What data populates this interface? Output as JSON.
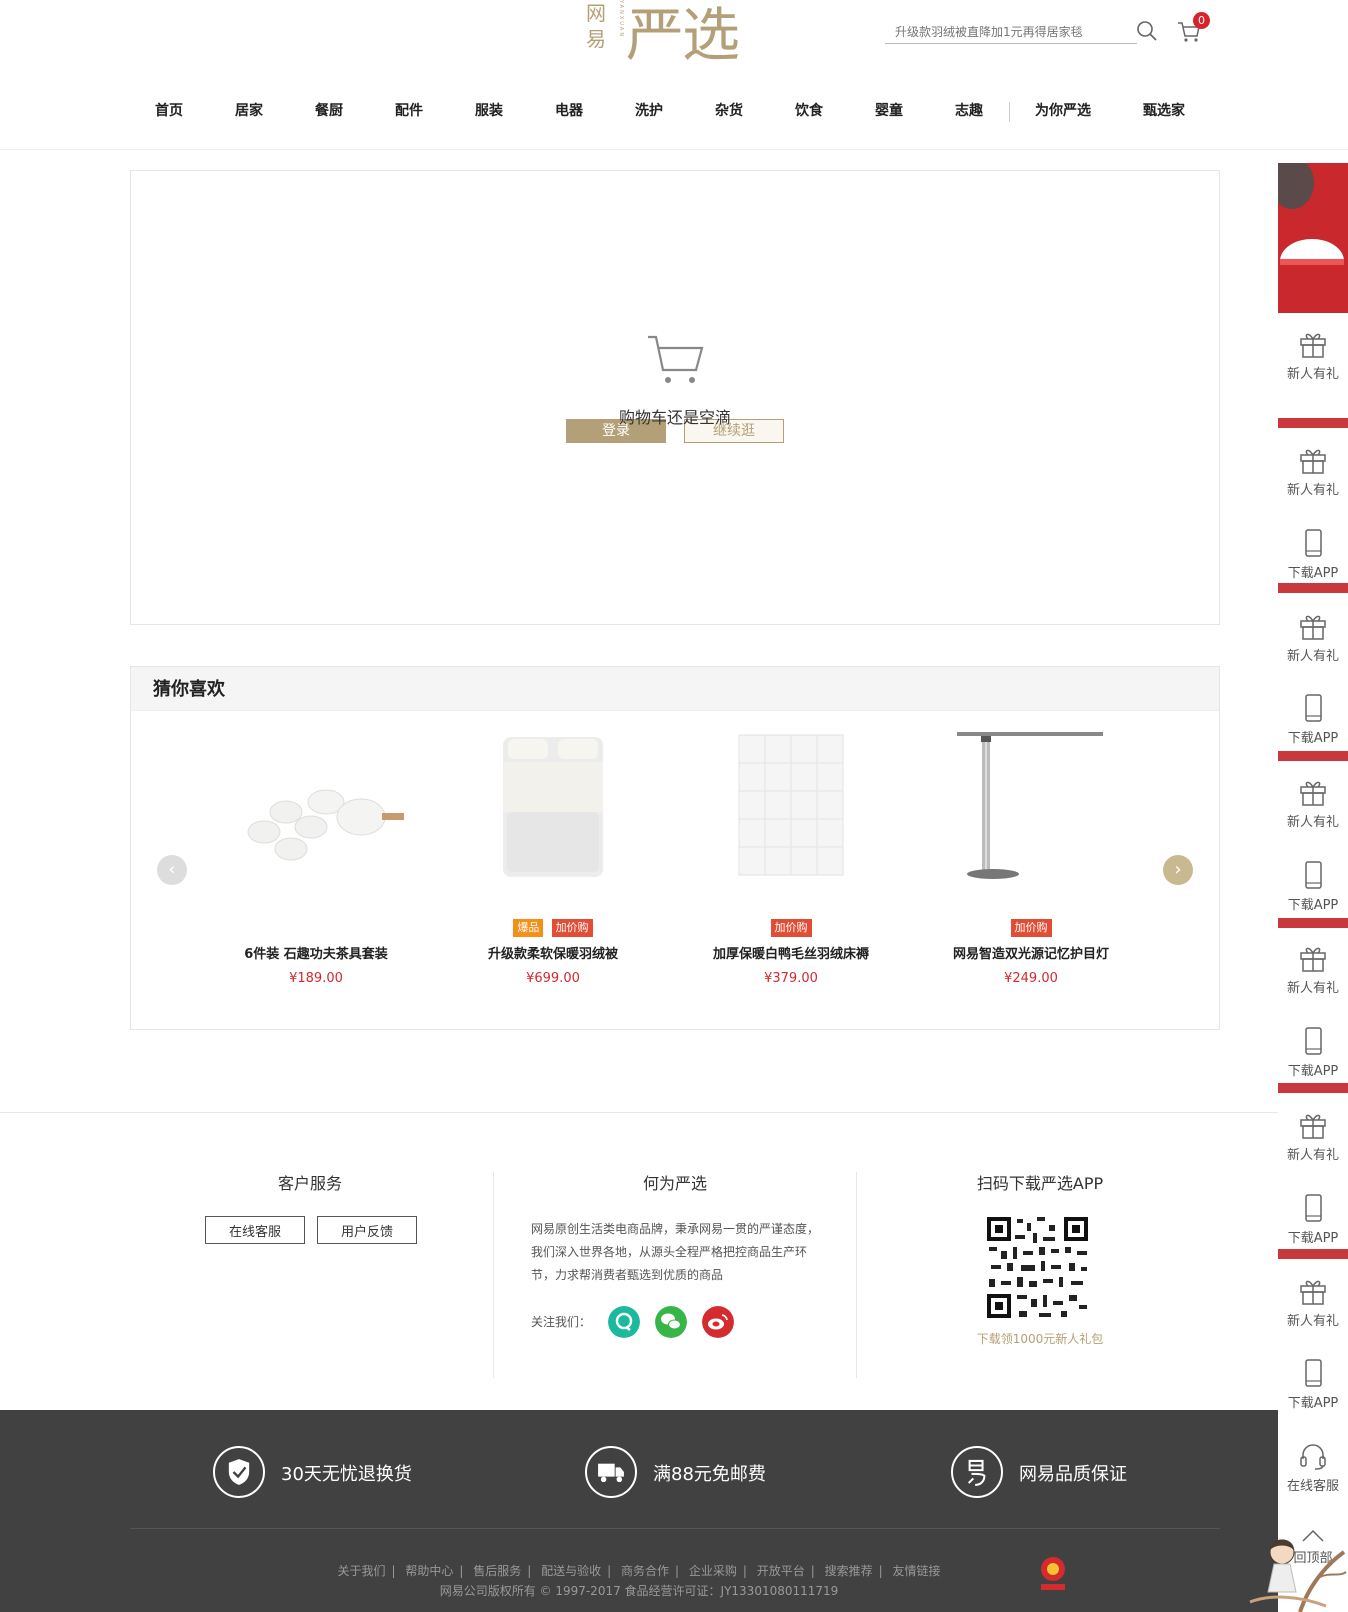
{
  "header": {
    "logo_small": "网易",
    "logo_vert": "YANXUAN",
    "logo_big": "严选",
    "search_placeholder": "升级款羽绒被直降加1元再得居家毯",
    "cart_count": "0"
  },
  "nav": [
    "首页",
    "居家",
    "餐厨",
    "配件",
    "服装",
    "电器",
    "洗护",
    "杂货",
    "饮食",
    "婴童",
    "志趣",
    "为你严选",
    "甄选家"
  ],
  "cart": {
    "empty_text": "购物车还是空滴",
    "login_label": "登录",
    "continue_label": "继续逛"
  },
  "recommend": {
    "title": "猜你喜欢",
    "prev": "‹",
    "next": "›",
    "products": [
      {
        "name": "6件装 石趣功夫茶具套装",
        "price": "¥189.00",
        "tags": []
      },
      {
        "name": "升级款柔软保暖羽绒被",
        "price": "¥699.00",
        "tags": [
          "爆品",
          "加价购"
        ]
      },
      {
        "name": "加厚保暖白鸭毛丝羽绒床褥",
        "price": "¥379.00",
        "tags": [
          "加价购"
        ]
      },
      {
        "name": "网易智造双光源记忆护目灯",
        "price": "¥249.00",
        "tags": [
          "加价购"
        ]
      }
    ]
  },
  "footer": {
    "service_title": "客户服务",
    "online_service": "在线客服",
    "feedback": "用户反馈",
    "about_title": "何为严选",
    "about_text": "网易原创生活类电商品牌，秉承网易一贯的严谨态度，我们深入世界各地，从源头全程严格把控商品生产环节，力求帮消费者甄选到优质的商品",
    "follow_label": "关注我们：",
    "app_title": "扫码下载严选APP",
    "app_gift": "下载领1000元新人礼包",
    "features": [
      "30天无忧退换货",
      "满88元免邮费",
      "网易品质保证"
    ],
    "links": [
      "关于我们",
      "帮助中心",
      "售后服务",
      "配送与验收",
      "商务合作",
      "企业采购",
      "开放平台",
      "搜索推荐",
      "友情链接"
    ],
    "copyright": "网易公司版权所有 © 1997-2017   食品经营许可证：JY13301080111719"
  },
  "sidebar": {
    "gift_label": "新人有礼",
    "app_label": "下载APP",
    "service_label": "在线客服",
    "top_label": "回顶部"
  },
  "colors": {
    "brand": "#b4a078",
    "price": "#d4282d",
    "dark_footer": "#414141",
    "sidebar_red": "#c9282d"
  }
}
